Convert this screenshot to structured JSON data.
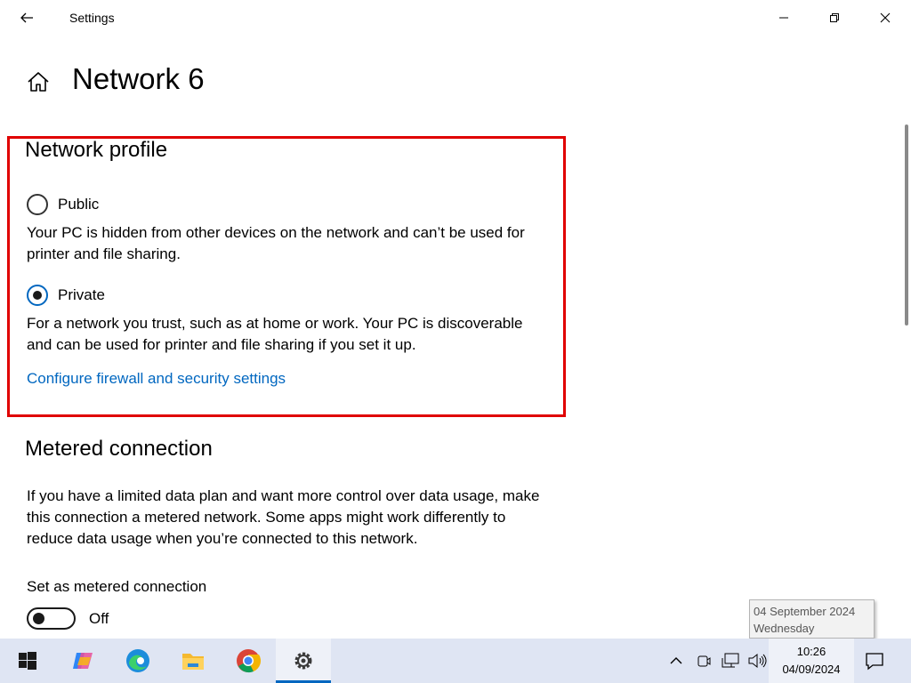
{
  "window": {
    "title": "Settings"
  },
  "page": {
    "title": "Network 6"
  },
  "network_profile": {
    "heading": "Network profile",
    "public_label": "Public",
    "public_desc": "Your PC is hidden from other devices on the network and can’t be used for printer and file sharing.",
    "private_label": "Private",
    "private_desc": "For a network you trust, such as at home or work. Your PC is discoverable and can be used for printer and file sharing if you set it up.",
    "selected": "Private",
    "firewall_link": "Configure firewall and security settings"
  },
  "metered": {
    "heading": "Metered connection",
    "desc": "If you have a limited data plan and want more control over data usage, make this connection a metered network. Some apps might work differently to reduce data usage when you’re connected to this network.",
    "toggle_label": "Set as metered connection",
    "toggle_state": "Off"
  },
  "tooltip": {
    "date_long": "04 September 2024",
    "weekday": "Wednesday"
  },
  "taskbar": {
    "apps": [
      "start-icon",
      "copilot-icon",
      "edge-icon",
      "file-explorer-icon",
      "chrome-icon",
      "settings-icon"
    ],
    "clock_time": "10:26",
    "clock_date": "04/09/2024"
  },
  "colors": {
    "accent": "#0067c0",
    "highlight": "#e00000",
    "taskbar": "#dfe5f3"
  }
}
